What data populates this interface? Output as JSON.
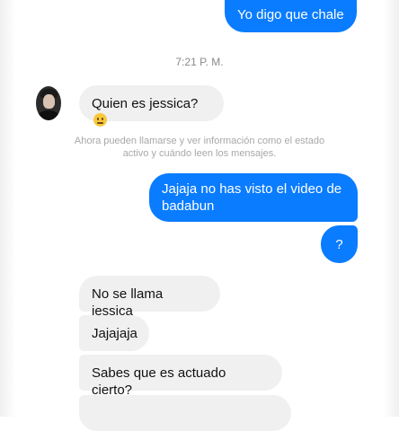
{
  "conversation": {
    "messages_top": {
      "out1": "Yo digo que chale"
    },
    "timestamp": "7:21 P. M.",
    "in1": "Quien es jessica?",
    "in1_emoji": "confused-face-icon",
    "notice": "Ahora pueden llamarse y ver información como el estado activo y cuándo leen los mensajes.",
    "out2": "Jajaja no has visto el video de badabun",
    "out3": "?",
    "in2": "No se llama jessica",
    "in3": "Jajajaja",
    "in4": "Sabes que es actuado cierto?",
    "in5": ""
  },
  "colors": {
    "outgoing_bubble": "#0a7cff",
    "incoming_bubble": "#f0f0f0",
    "meta_text": "#8a8a8a"
  }
}
